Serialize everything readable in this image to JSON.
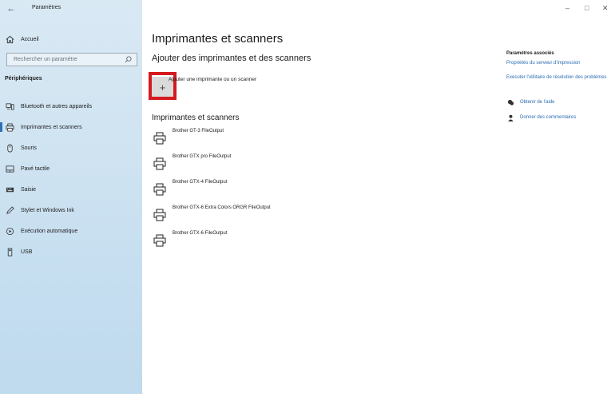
{
  "window": {
    "title": "Paramètres",
    "controls": {
      "minimize": "–",
      "maximize": "□",
      "close": "✕"
    }
  },
  "sidebar": {
    "home_label": "Accueil",
    "search_placeholder": "Rechercher un paramètre",
    "section_title": "Périphériques",
    "items": [
      {
        "label": "Bluetooth et autres appareils",
        "icon": "bluetooth-devices-icon",
        "active": false
      },
      {
        "label": "Imprimantes et scanners",
        "icon": "printer-icon",
        "active": true
      },
      {
        "label": "Souris",
        "icon": "mouse-icon",
        "active": false
      },
      {
        "label": "Pavé tactile",
        "icon": "touchpad-icon",
        "active": false
      },
      {
        "label": "Saisie",
        "icon": "keyboard-icon",
        "active": false
      },
      {
        "label": "Stylet et Windows Ink",
        "icon": "pen-icon",
        "active": false
      },
      {
        "label": "Exécution automatique",
        "icon": "autoplay-icon",
        "active": false
      },
      {
        "label": "USB",
        "icon": "usb-icon",
        "active": false
      }
    ]
  },
  "main": {
    "title": "Imprimantes et scanners",
    "add_section_title": "Ajouter des imprimantes et des scanners",
    "add_button_symbol": "+",
    "add_label": "Ajouter une imprimante ou un scanner",
    "printers_title": "Imprimantes et scanners",
    "printers": [
      "Brother GT-3 FileOutput",
      "Brother GTX pro FileOutput",
      "Brother GTX-4 FileOutput",
      "Brother GTX-6 Extra Colors ORGR FileOutput",
      "Brother GTX-6 FileOutput"
    ]
  },
  "related": {
    "title": "Paramètres associés",
    "links": [
      "Propriétés du serveur d'impression",
      "Exécuter l'utilitaire de résolution des problèmes"
    ],
    "help": [
      {
        "label": "Obtenir de l'aide",
        "icon": "help-chat-icon"
      },
      {
        "label": "Donner des commentaires",
        "icon": "feedback-icon"
      }
    ]
  },
  "colors": {
    "accent": "#2c6fb8",
    "link": "#2a6cb3",
    "highlight_box": "#d41a1f",
    "sidebar_bg": "#cfe3f1"
  }
}
